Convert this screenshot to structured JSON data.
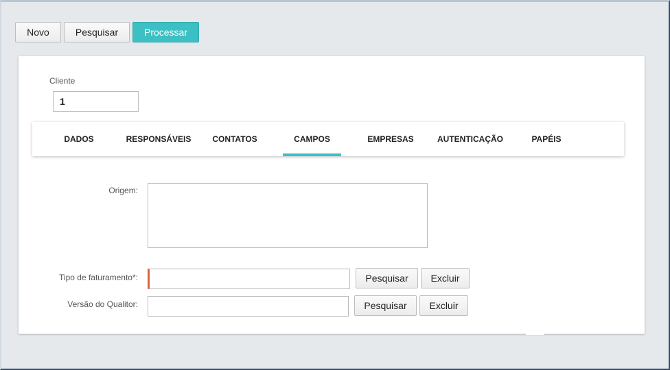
{
  "toolbar": {
    "novo_label": "Novo",
    "pesquisar_label": "Pesquisar",
    "processar_label": "Processar"
  },
  "cliente": {
    "label": "Cliente",
    "value": "1"
  },
  "tabs": [
    {
      "label": "DADOS"
    },
    {
      "label": "RESPONSÁVEIS"
    },
    {
      "label": "CONTATOS"
    },
    {
      "label": "CAMPOS"
    },
    {
      "label": "EMPRESAS"
    },
    {
      "label": "AUTENTICAÇÃO"
    },
    {
      "label": "PAPÉIS"
    }
  ],
  "active_tab": "CAMPOS",
  "fields": {
    "origem": {
      "label": "Origem:",
      "value": ""
    },
    "tipo_faturamento": {
      "label": "Tipo de faturamento*:",
      "value": "",
      "pesquisar_label": "Pesquisar",
      "excluir_label": "Excluir"
    },
    "versao_qualitor": {
      "label": "Versão do Qualitor:",
      "value": "",
      "pesquisar_label": "Pesquisar",
      "excluir_label": "Excluir"
    }
  },
  "colors": {
    "accent": "#3cc0c4",
    "required_marker": "#d9653c",
    "background": "#e5e9ec"
  }
}
